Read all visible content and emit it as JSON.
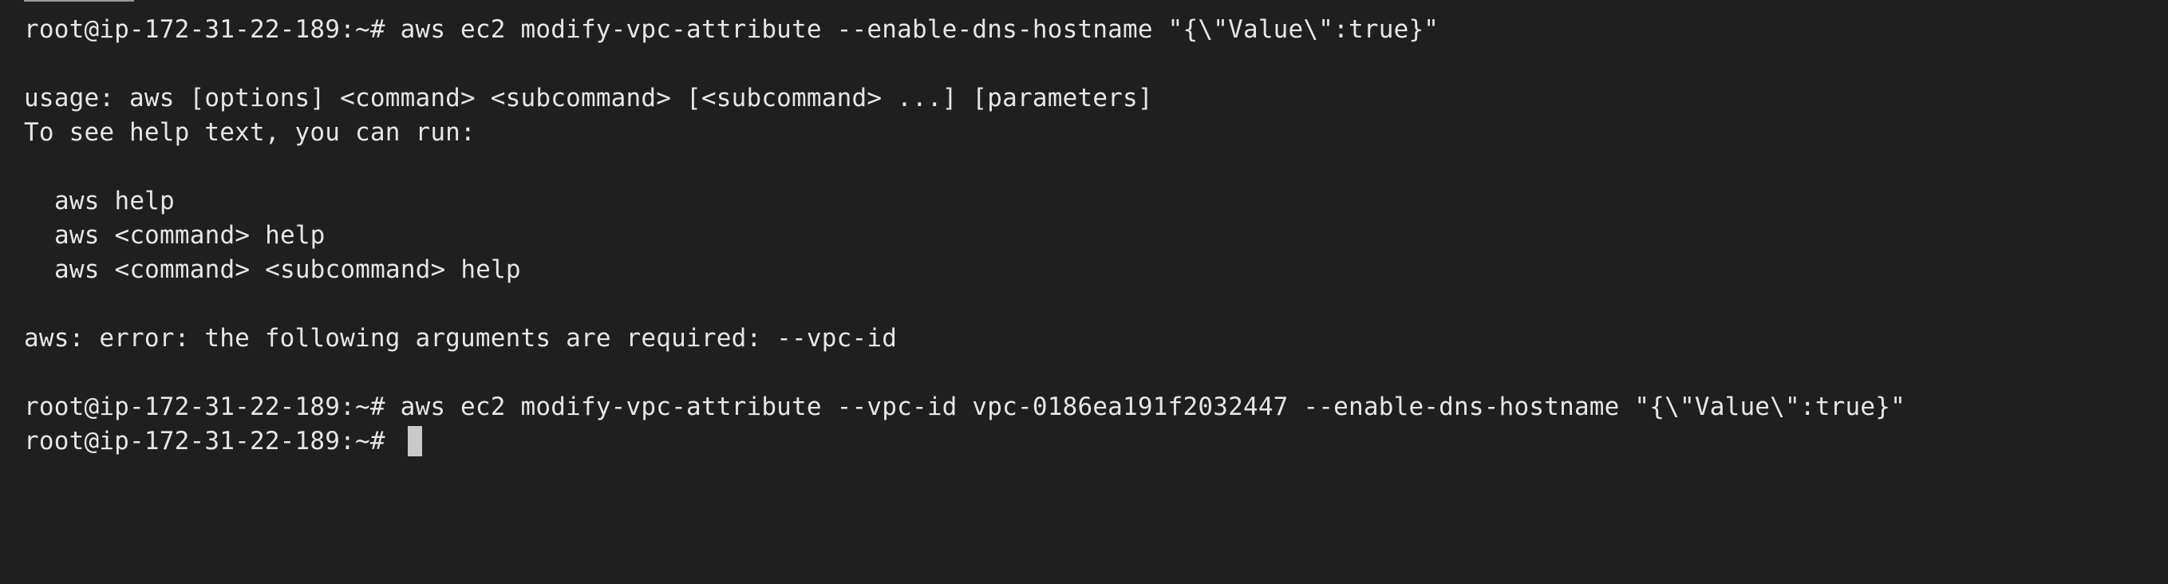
{
  "terminal": {
    "lines": [
      "root@ip-172-31-22-189:~# aws ec2 modify-vpc-attribute --enable-dns-hostname \"{\\\"Value\\\":true}\"",
      "usage: aws [options] <command> <subcommand> [<subcommand> ...] [parameters]",
      "To see help text, you can run:",
      "aws help",
      "aws <command> help",
      "aws <command> <subcommand> help",
      "aws: error: the following arguments are required: --vpc-id",
      "root@ip-172-31-22-189:~# aws ec2 modify-vpc-attribute --vpc-id vpc-0186ea191f2032447 --enable-dns-hostname \"{\\\"Value\\\":true}\"",
      "root@ip-172-31-22-189:~#"
    ]
  },
  "colors": {
    "background": "#1f1f1f",
    "text": "#e6e6e6",
    "cursor": "#c9c9c9"
  }
}
